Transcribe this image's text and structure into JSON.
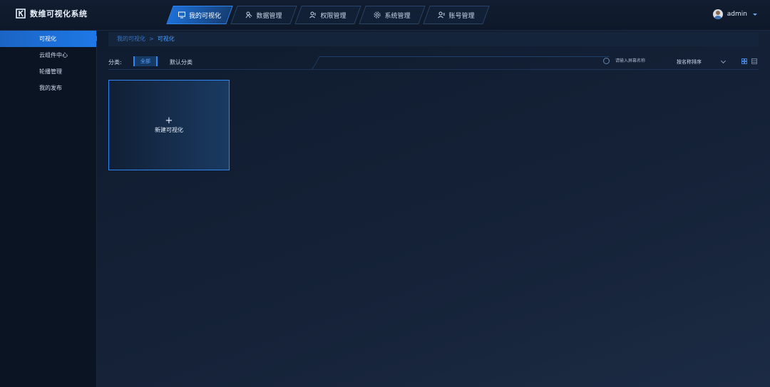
{
  "app": {
    "title": "数维可视化系统"
  },
  "nav": {
    "items": [
      {
        "label": "我的可视化",
        "icon": "monitor-icon",
        "active": true
      },
      {
        "label": "数据管理",
        "icon": "database-icon",
        "active": false
      },
      {
        "label": "权限管理",
        "icon": "permission-icon",
        "active": false
      },
      {
        "label": "系统管理",
        "icon": "gear-icon",
        "active": false
      },
      {
        "label": "账号管理",
        "icon": "account-icon",
        "active": false
      }
    ]
  },
  "user": {
    "name": "admin"
  },
  "sidebar": {
    "items": [
      {
        "label": "可视化",
        "active": true
      },
      {
        "label": "云组件中心",
        "active": false
      },
      {
        "label": "轮播管理",
        "active": false
      },
      {
        "label": "我的发布",
        "active": false
      }
    ]
  },
  "breadcrumb": {
    "home": "我的可视化",
    "separator": ">",
    "current": "可视化"
  },
  "filter": {
    "label": "分类:",
    "all": "全部",
    "default": "默认分类",
    "search_placeholder": "请输入屏幕名称",
    "sort": "按名称排序"
  },
  "card": {
    "plus": "+",
    "label": "新建可视化"
  },
  "colors": {
    "accent": "#1d78e6",
    "background": "#0c1626",
    "border_active": "#2f86f0"
  }
}
